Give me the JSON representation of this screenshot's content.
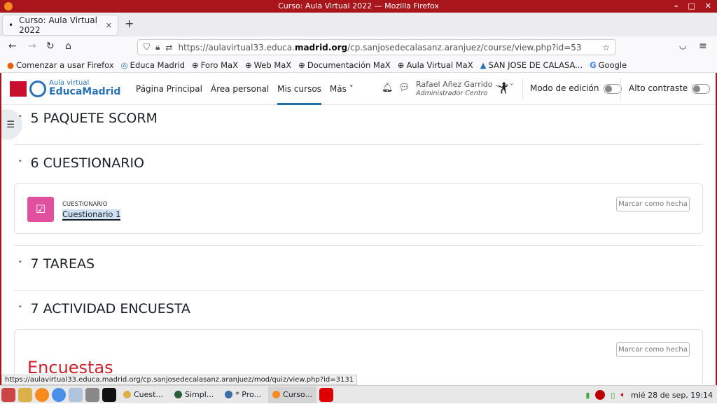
{
  "window": {
    "title": "Curso: Aula Virtual 2022 — Mozilla Firefox"
  },
  "tab": {
    "label": "Curso: Aula Virtual 2022"
  },
  "url": {
    "prefix": "https://aulavirtual33.educa.",
    "domain": "madrid.org",
    "suffix": "/cp.sanjosedecalasanz.aranjuez/course/view.php?id=53"
  },
  "bookmarks": [
    "Comenzar a usar Firefox",
    "Educa Madrid",
    "Foro MaX",
    "Web MaX",
    "Documentación MaX",
    "Aula Virtual MaX",
    "SAN JOSE DE CALASA...",
    "Google"
  ],
  "site": {
    "logo_top": "Aula virtual",
    "logo_bottom": "EducaMadrid",
    "nav": [
      "Página Principal",
      "Área personal",
      "Mis cursos",
      "Más"
    ],
    "user_name": "Rafael Añez Garrido",
    "user_role": "Administrador Centro",
    "edit_mode": "Modo de edición",
    "high_contrast": "Alto contraste",
    "edit_mode_on": false,
    "high_contrast_on": false
  },
  "sections": [
    {
      "title": "5 PAQUETE SCORM"
    },
    {
      "title": "6 CUESTIONARIO",
      "activity_type": "CUESTIONARIO",
      "activity_name": "Cuestionario 1",
      "mark_label": "Marcar como hecha"
    },
    {
      "title": "7 TAREAS"
    },
    {
      "title": "7 ACTIVIDAD ENCUESTA",
      "mark_label": "Marcar como hecha",
      "heading": "Encuestas"
    }
  ],
  "status_url": "https://aulavirtual33.educa.madrid.org/cp.sanjosedecalasanz.aranjuez/mod/quiz/view.php?id=3131",
  "taskbar": {
    "tasks": [
      "Cuest...",
      "Simpl...",
      "* Pro...",
      "Curso..."
    ],
    "clock": "mié 28 de sep, 19:14"
  },
  "colors": {
    "titlebar": "#a8161b",
    "accent": "#1f6fa8",
    "quiz_icon": "#e0509e",
    "encuestas": "#d0202a"
  }
}
